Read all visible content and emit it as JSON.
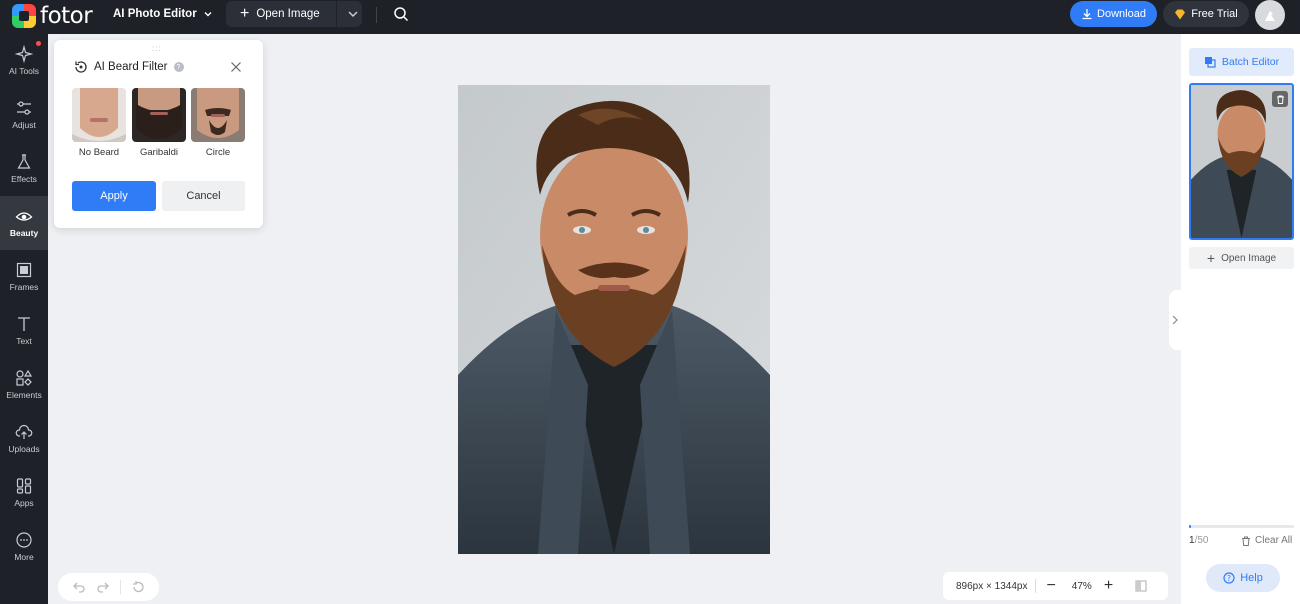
{
  "app": {
    "logo_text": "fotor",
    "mode_label": "AI Photo Editor",
    "open_image_label": "Open Image",
    "download_label": "Download",
    "free_trial_label": "Free Trial"
  },
  "sidebar": {
    "items": [
      {
        "label": "AI Tools",
        "icon": "sparkle-icon"
      },
      {
        "label": "Adjust",
        "icon": "sliders-icon"
      },
      {
        "label": "Effects",
        "icon": "flask-icon"
      },
      {
        "label": "Beauty",
        "icon": "eye-icon"
      },
      {
        "label": "Frames",
        "icon": "frame-icon"
      },
      {
        "label": "Text",
        "icon": "text-icon"
      },
      {
        "label": "Elements",
        "icon": "shapes-icon"
      },
      {
        "label": "Uploads",
        "icon": "cloud-upload-icon"
      },
      {
        "label": "Apps",
        "icon": "apps-icon"
      },
      {
        "label": "More",
        "icon": "more-icon"
      }
    ],
    "active": "Beauty"
  },
  "beard_panel": {
    "title": "AI Beard Filter",
    "options": [
      {
        "label": "No Beard"
      },
      {
        "label": "Garibaldi"
      },
      {
        "label": "Circle"
      }
    ],
    "apply_label": "Apply",
    "cancel_label": "Cancel"
  },
  "canvas": {
    "dimensions": "896px × 1344px",
    "zoom": "47%"
  },
  "right_panel": {
    "batch_label": "Batch Editor",
    "open_image_label": "Open Image",
    "count_current": "1",
    "count_total": "/50",
    "upload_progress": 0.02,
    "clear_label": "Clear All",
    "help_label": "Help"
  },
  "colors": {
    "accent": "#2f7cf6",
    "topbar": "#1e2127"
  }
}
